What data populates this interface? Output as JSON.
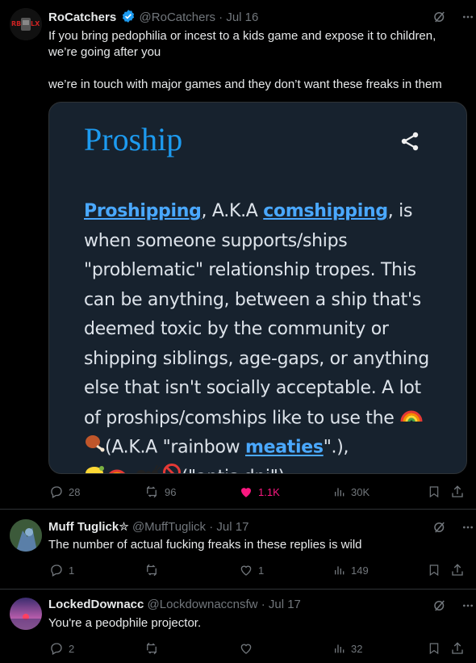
{
  "colors": {
    "background": "#000000",
    "text": "#e7e9ea",
    "muted": "#71767b",
    "accent": "#1d9bf0",
    "like": "#f91880",
    "card": "#17222e"
  },
  "tweet1": {
    "name": "RoCatchers",
    "handle": "@RoCatchers",
    "time": "· Jul 16",
    "verified_icon": "verified-badge-icon",
    "text_line1": "If you bring pedophilia or incest to a kids game and expose it to children,",
    "text_line2": "we’re going after you",
    "text_line3": "we’re in touch with major games and they don’t want these freaks in them",
    "card": {
      "title": "Proship",
      "link1": "Proshipping",
      "text1": ", A.K.A ",
      "link2": "comshipping",
      "text2": ", is when someone supports/ships \"problematic\" relationship tropes. This can be anything, between a ship that's deemed toxic by the community or shipping siblings, age-gaps, or anything else that isn't socially acceptable. A lot of proships/comships like to use the ",
      "text3": "(A.K.A \"rainbow ",
      "link3": "meaties",
      "text4": "\".),",
      "text5": ",",
      "text6": "(\"antis dni\")"
    },
    "actions": {
      "replies": "28",
      "reposts": "96",
      "likes": "1.1K",
      "views": "30K"
    }
  },
  "tweet2": {
    "name": "Muff Tuglick✮",
    "handle": "@MuffTuglick",
    "time": "· Jul 17",
    "text": "The number of actual fucking freaks in these replies is wild",
    "actions": {
      "replies": "1",
      "reposts": "",
      "likes": "1",
      "views": "149"
    }
  },
  "tweet3": {
    "name": "LockedDownacc",
    "handle": "@Lockdownaccnsfw",
    "time": "· Jul 17",
    "text": "You're a peodphile projector.",
    "actions": {
      "replies": "2",
      "reposts": "",
      "likes": "",
      "views": "32"
    }
  }
}
